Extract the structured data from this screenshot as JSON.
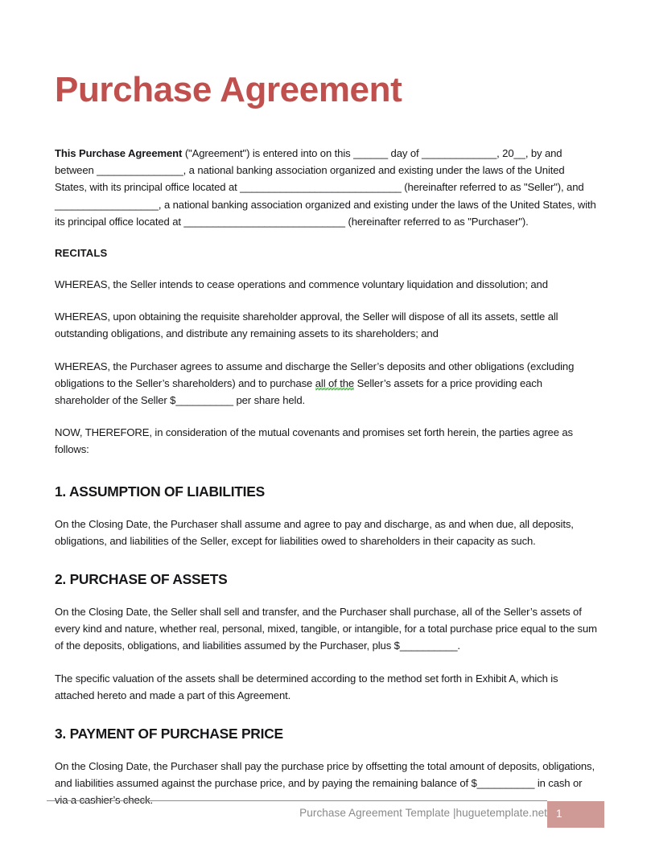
{
  "document": {
    "title": "Purchase Agreement",
    "title_color": "#c0504d"
  },
  "intro": {
    "bold_lead": "This Purchase Agreement",
    "rest": " (\"Agreement\") is entered into on this ______ day of _____________, 20__, by and between _______________, a national banking association organized and existing under the laws of the United States, with its principal office located at ____________________________ (hereinafter referred to as \"Seller\"), and __________________, a national banking association organized and existing under the laws of the United States, with its principal office located at ____________________________ (hereinafter referred to as \"Purchaser\")."
  },
  "recitals": {
    "heading": "RECITALS",
    "paragraphs": [
      "WHEREAS, the Seller intends to cease operations and commence voluntary liquidation and dissolution; and",
      "WHEREAS, upon obtaining the requisite shareholder approval, the Seller will dispose of all its assets, settle all outstanding obligations, and distribute any remaining assets to its shareholders; and"
    ],
    "third_part_a": "WHEREAS, the Purchaser agrees to assume and discharge the Seller’s deposits and other obligations (excluding obligations to the Seller’s shareholders) and to purchase ",
    "third_flagged": "all of the",
    "third_part_b": " Seller’s assets for a price providing each shareholder of the Seller $__________ per share held.",
    "now_therefore": "NOW, THEREFORE, in consideration of the mutual covenants and promises set forth herein, the parties agree as follows:"
  },
  "sections": [
    {
      "heading": "1. ASSUMPTION OF LIABILITIES",
      "body": [
        "On the Closing Date, the Purchaser shall assume and agree to pay and discharge, as and when due, all deposits, obligations, and liabilities of the Seller, except for liabilities owed to shareholders in their capacity as such."
      ]
    },
    {
      "heading": "2. PURCHASE OF ASSETS",
      "body": [
        "On the Closing Date, the Seller shall sell and transfer, and the Purchaser shall purchase, all of the Seller’s assets of every kind and nature, whether real, personal, mixed, tangible, or intangible, for a total purchase price equal to the sum of the deposits, obligations, and liabilities assumed by the Purchaser, plus $__________.",
        "The specific valuation of the assets shall be determined according to the method set forth in Exhibit A, which is attached hereto and made a part of this Agreement."
      ]
    },
    {
      "heading": "3. PAYMENT OF PURCHASE PRICE",
      "body": [
        "On the Closing Date, the Purchaser shall pay the purchase price by offsetting the total amount of deposits, obligations, and liabilities assumed against the purchase price, and by paying the remaining balance of $__________ in cash or via a cashier’s check."
      ]
    }
  ],
  "footer": {
    "text": "Purchase Agreement Template |huguetemplate.net",
    "page_number": "1",
    "box_color": "#cf9a96"
  }
}
